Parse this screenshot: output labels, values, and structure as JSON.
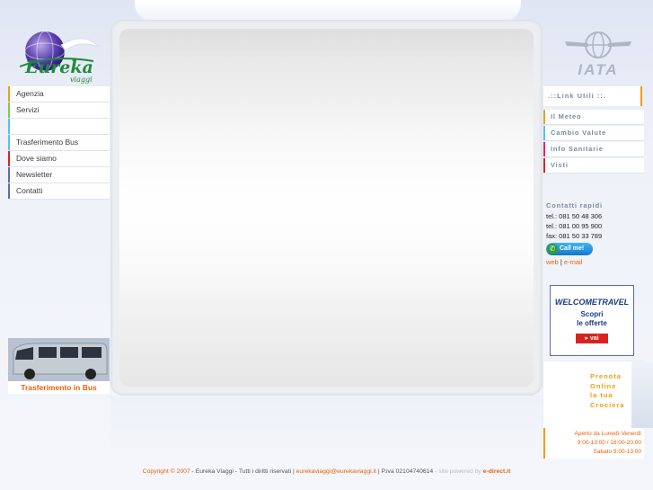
{
  "colors": {
    "accent": "#f39c12",
    "link": "#e8620c",
    "nav_blue": "#7b8aa0",
    "brand_blue": "#1c3a84"
  },
  "logo": {
    "text": "Eureka",
    "subtext": "viaggi",
    "icon": "globe-logo-icon"
  },
  "menu": {
    "items": [
      {
        "label": "Agenzia",
        "accent": "#f39c12"
      },
      {
        "label": "Servizi",
        "accent": "#8bc34a"
      },
      {
        "label": "",
        "accent": "#4fc3f7"
      },
      {
        "label": "Trasferimento Bus",
        "accent": "#4fc3f7"
      },
      {
        "label": "Dove siamo",
        "accent": "#d9231f"
      },
      {
        "label": "Newsletter",
        "accent": "#5a6fa6"
      },
      {
        "label": "Contatti",
        "accent": "#5a6fa6"
      }
    ]
  },
  "promo": {
    "caption": "Trasferimento in Bus"
  },
  "iata": {
    "label": "IATA",
    "icon": "iata-globe-icon"
  },
  "links": {
    "title": ".::Link Utili ::.",
    "items": [
      {
        "label": "Il Meteo",
        "accent": "#f39c12"
      },
      {
        "label": "Cambio Valute",
        "accent": "#4fc3f7"
      },
      {
        "label": "Info Sanitarie",
        "accent": "#e91e63"
      },
      {
        "label": "Visti",
        "accent": "#d9231f"
      }
    ]
  },
  "contacts": {
    "title": "Contatti rapidi",
    "tel1": "tel.: 081 50 48 306",
    "tel2": "tel.: 081 00 95 900",
    "fax": "fax: 081 50 33 789",
    "callme": "Call me!",
    "web": "web",
    "sep": "|",
    "email": "e-mail"
  },
  "welcome": {
    "brand": "WELCOMETRAVEL",
    "line1": "Scopri",
    "line2": "le offerte",
    "button": "vai"
  },
  "cruise": {
    "line1": "Prenota",
    "line2": "Online",
    "line3": "la tua",
    "line4": "Crociera"
  },
  "hours": {
    "line1": "Aperto da Lunedì-Venerdì",
    "line2": "9:00-13:00 / 16:00-20:00",
    "line3": "Sabato 9:00-13:00"
  },
  "footer": {
    "copyright": "Copyright © 2007",
    "company": " - Eureka Viaggi - Tutti i diritti riservati | ",
    "email": "eurekaviaggi@eurekaviaggi.it",
    "piva": " | P.iva 02104740614",
    "powered": " - site powered by ",
    "powered_brand": "e-direct.it"
  }
}
